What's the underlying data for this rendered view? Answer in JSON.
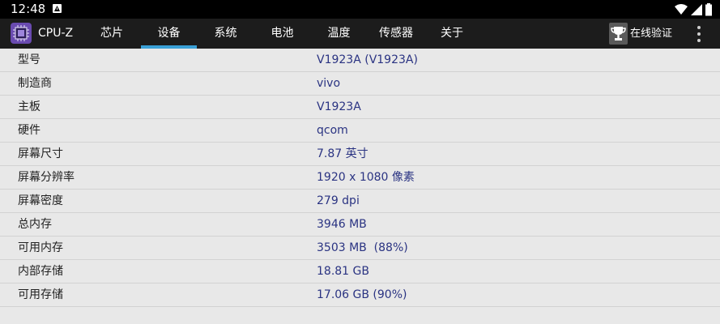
{
  "status_bar": {
    "time": "12:48"
  },
  "app": {
    "title": "CPU-Z"
  },
  "tabs": [
    {
      "label": "芯片",
      "active": false
    },
    {
      "label": "设备",
      "active": true
    },
    {
      "label": "系统",
      "active": false
    },
    {
      "label": "电池",
      "active": false
    },
    {
      "label": "温度",
      "active": false
    },
    {
      "label": "传感器",
      "active": false
    },
    {
      "label": "关于",
      "active": false
    }
  ],
  "toolbar": {
    "validate_label": "在线验证"
  },
  "rows": [
    {
      "label": "型号",
      "value": "V1923A (V1923A)"
    },
    {
      "label": "制造商",
      "value": "vivo"
    },
    {
      "label": "主板",
      "value": "V1923A"
    },
    {
      "label": "硬件",
      "value": "qcom"
    },
    {
      "label": "屏幕尺寸",
      "value": "7.87 英寸"
    },
    {
      "label": "屏幕分辨率",
      "value": "1920 x 1080 像素"
    },
    {
      "label": "屏幕密度",
      "value": "279 dpi"
    },
    {
      "label": "总内存",
      "value": "3946 MB"
    },
    {
      "label": "可用内存",
      "value": "3503 MB  (88%)"
    },
    {
      "label": "内部存储",
      "value": "18.81 GB"
    },
    {
      "label": "可用存储",
      "value": "17.06 GB (90%)"
    }
  ],
  "colors": {
    "accent": "#3aa0d6",
    "value_text": "#2a3382",
    "app_bar": "#1c1c1c",
    "background": "#e8e8e8"
  }
}
